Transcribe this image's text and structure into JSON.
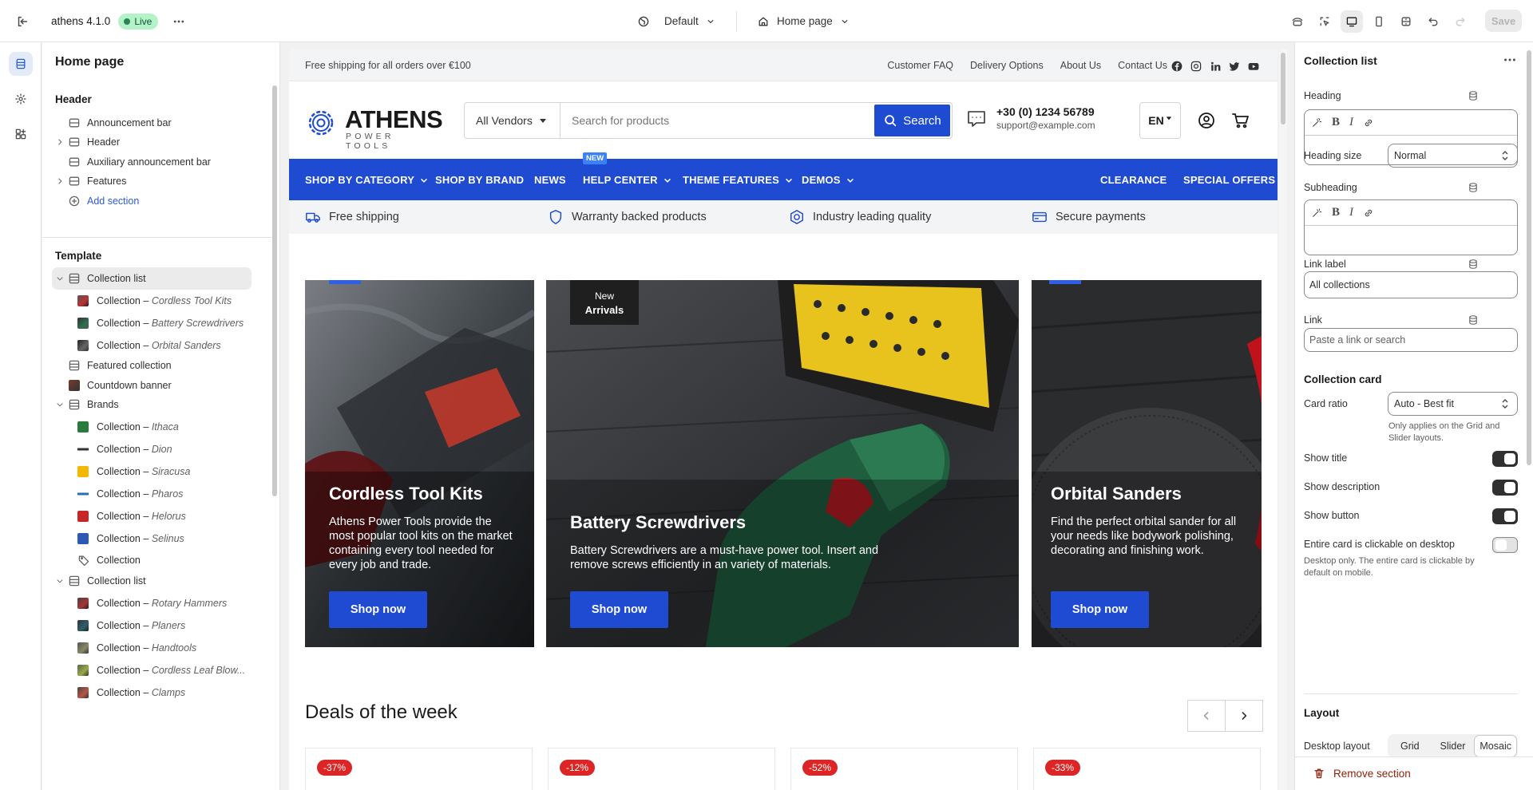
{
  "topbar": {
    "theme_name": "athens 4.1.0",
    "live_label": "Live",
    "theme_select": "Default",
    "page_select": "Home page",
    "save_label": "Save"
  },
  "sidebar": {
    "title": "Home page",
    "header_heading": "Header",
    "header_items": [
      "Announcement bar",
      "Header",
      "Auxiliary announcement bar",
      "Features"
    ],
    "add_section": "Add section",
    "template_heading": "Template",
    "collection_prefix": "Collection –",
    "template_items": {
      "collection_list_1": "Collection list",
      "c1": "Cordless Tool Kits",
      "c2": "Battery Screwdrivers",
      "c3": "Orbital Sanders",
      "featured": "Featured collection",
      "countdown": "Countdown banner",
      "brands": "Brands",
      "b1": "Ithaca",
      "b2": "Dion",
      "b3": "Siracusa",
      "b4": "Pharos",
      "b5": "Helorus",
      "b6": "Selinus",
      "b7": "Collection",
      "collection_list_2": "Collection list",
      "d1": "Rotary Hammers",
      "d2": "Planers",
      "d3": "Handtools",
      "d4": "Cordless Leaf Blow...",
      "d5": "Clamps"
    }
  },
  "preview": {
    "announcement": "Free shipping for all orders over €100",
    "announce_links": [
      "Customer FAQ",
      "Delivery Options",
      "About Us",
      "Contact Us"
    ],
    "logo_word": "ATHENS",
    "logo_sub": "POWER TOOLS",
    "vendor_select": "All Vendors",
    "search_placeholder": "Search for products",
    "search_button": "Search",
    "phone": "+30 (0) 1234 56789",
    "email": "support@example.com",
    "lang": "EN",
    "nav": [
      "SHOP BY CATEGORY",
      "SHOP BY BRAND",
      "NEWS",
      "HELP CENTER",
      "THEME FEATURES",
      "DEMOS",
      "CLEARANCE",
      "SPECIAL OFFERS"
    ],
    "new_tag": "NEW",
    "usp": [
      "Free shipping",
      "Warranty backed products",
      "Industry leading quality",
      "Secure payments"
    ],
    "cards": [
      {
        "title": "Cordless Tool Kits",
        "desc": "Athens Power Tools provide the most popular tool kits on the market containing every tool needed for every job and trade.",
        "button": "Shop now"
      },
      {
        "title": "Battery Screwdrivers",
        "desc": "Battery Screwdrivers are a must-have power tool. Insert and remove screws efficiently in an variety of materials.",
        "button": "Shop now"
      },
      {
        "title": "Orbital Sanders",
        "desc": "Find the perfect orbital sander for all your needs like bodywork polishing, decorating and finishing work.",
        "button": "Shop now"
      }
    ],
    "new_arrivals_top": "New",
    "new_arrivals_bottom": "Arrivals",
    "deals_title": "Deals of the week",
    "deal_discounts": [
      "-37%",
      "-12%",
      "-52%",
      "-33%"
    ]
  },
  "panel": {
    "title": "Collection list",
    "heading_label": "Heading",
    "heading_size_label": "Heading size",
    "heading_size_value": "Normal",
    "subheading_label": "Subheading",
    "link_label_label": "Link label",
    "link_label_value": "All collections",
    "link_label": "Link",
    "link_placeholder": "Paste a link or search",
    "collection_card_heading": "Collection card",
    "card_ratio_label": "Card ratio",
    "card_ratio_value": "Auto - Best fit",
    "card_ratio_help": "Only applies on the Grid and Slider layouts.",
    "show_title": "Show title",
    "show_description": "Show description",
    "show_button": "Show button",
    "entire_card": "Entire card is clickable on desktop",
    "entire_card_help": "Desktop only. The entire card is clickable by default on mobile.",
    "layout_heading": "Layout",
    "desktop_layout_label": "Desktop layout",
    "layout_options": [
      "Grid",
      "Slider",
      "Mosaic"
    ],
    "remove_section": "Remove section"
  }
}
